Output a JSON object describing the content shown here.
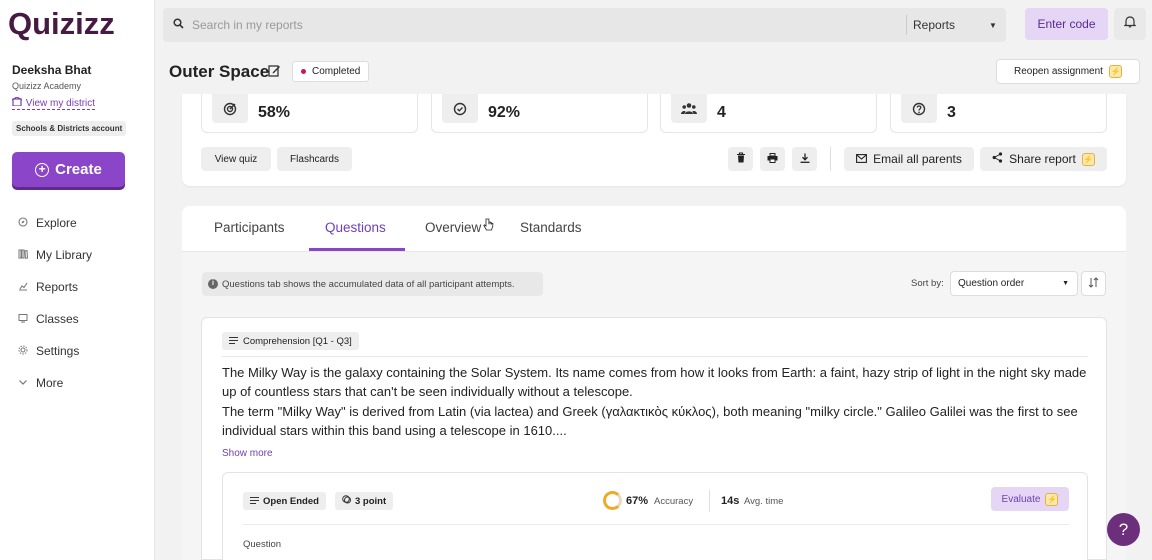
{
  "app": {
    "logo": "Quizizz"
  },
  "user": {
    "name": "Deeksha Bhat",
    "org": "Quizizz Academy",
    "district_link": "View my district",
    "account_badge": "Schools & Districts account"
  },
  "sidebar": {
    "create_label": "Create",
    "items": [
      {
        "label": "Explore",
        "icon": "compass-icon"
      },
      {
        "label": "My Library",
        "icon": "library-icon"
      },
      {
        "label": "Reports",
        "icon": "chart-icon"
      },
      {
        "label": "Classes",
        "icon": "classes-icon"
      },
      {
        "label": "Settings",
        "icon": "gear-icon"
      },
      {
        "label": "More",
        "icon": "chevron-down-icon"
      }
    ]
  },
  "topbar": {
    "search_placeholder": "Search in my reports",
    "search_scope": "Reports",
    "enter_code": "Enter code"
  },
  "header": {
    "title": "Outer Space",
    "status": "Completed",
    "reopen": "Reopen assignment"
  },
  "stats": [
    {
      "value": "58%",
      "icon": "target-icon"
    },
    {
      "value": "92%",
      "icon": "check-circle-icon"
    },
    {
      "value": "4",
      "icon": "participants-icon"
    },
    {
      "value": "3",
      "icon": "question-icon"
    }
  ],
  "actions": {
    "view_quiz": "View quiz",
    "flashcards": "Flashcards",
    "email_parents": "Email all parents",
    "share_report": "Share report"
  },
  "tabs": {
    "items": [
      "Participants",
      "Questions",
      "Overview",
      "Standards"
    ],
    "active": "Questions"
  },
  "questions": {
    "info": "Questions tab shows the accumulated data of all participant attempts.",
    "sort_label": "Sort by:",
    "sort_value": "Question order",
    "comprehension_label": "Comprehension [Q1 - Q3]",
    "passage_p1": "The Milky Way is the galaxy containing the Solar System. Its name comes from how it looks from Earth: a faint, hazy strip of light in the night sky made up of countless stars that can't be seen individually without a telescope.",
    "passage_p2": "The term \"Milky Way\" is derived from Latin (via lactea) and Greek (γαλακτικὸς κύκλος), both meaning \"milky circle.\" Galileo Galilei was the first to see individual stars within this band using a telescope in 1610....",
    "show_more": "Show more",
    "q1": {
      "type": "Open Ended",
      "points": "3 point",
      "accuracy_value": "67%",
      "accuracy_fraction": 0.67,
      "accuracy_label": "Accuracy",
      "time_value": "14s",
      "time_label": "Avg. time",
      "evaluate": "Evaluate",
      "section_label": "Question"
    }
  },
  "colors": {
    "brand_purple": "#8a45c9",
    "status_dot": "#d0135a",
    "accuracy_ring": "#f0a928"
  }
}
